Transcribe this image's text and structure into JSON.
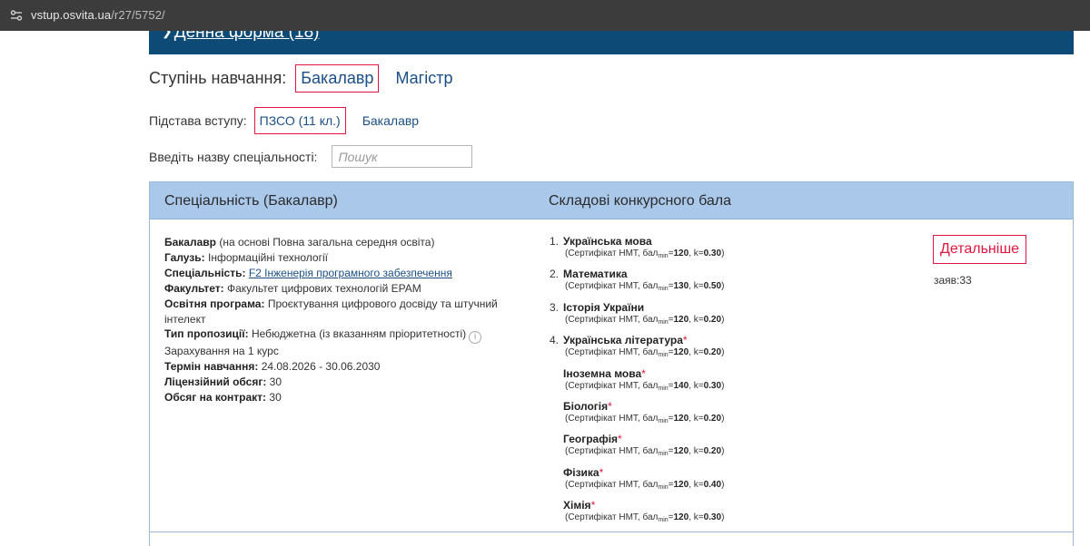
{
  "browser": {
    "url_host": "vstup.osvita.ua",
    "url_path": "/r27/5752/"
  },
  "strip": {
    "label": "Денна форма (18)"
  },
  "degree": {
    "label": "Ступінь навчання:",
    "options": [
      "Бакалавр",
      "Магістр"
    ],
    "selected": "Бакалавр"
  },
  "basis": {
    "label": "Підстава вступу:",
    "options": [
      "ПЗСО (11 кл.)",
      "Бакалавр"
    ],
    "selected": "ПЗСО (11 кл.)"
  },
  "search": {
    "label": "Введіть назву спеціальності:",
    "placeholder": "Пошук"
  },
  "table": {
    "col_spec": "Спеціальність (Бакалавр)",
    "col_score": "Складові конкурсного бала"
  },
  "offer": {
    "degree": "Бакалавр",
    "degree_note": "(на основі Повна загальна середня освіта)",
    "field_label": "Галузь:",
    "field_value": "Інформаційні технології",
    "spec_label": "Спеціальність:",
    "spec_value": "F2 Інженерія програмного забезпечення",
    "faculty_label": "Факультет:",
    "faculty_value": "Факультет цифрових технологій EPAM",
    "program_label": "Освітня програма:",
    "program_value": "Проєктування цифрового досвіду та штучний інтелект",
    "type_label": "Тип пропозиції:",
    "type_value": "Небюджетна (із вказанням пріоритетності)",
    "enroll": "Зарахування на 1 курс",
    "term_label": "Термін навчання:",
    "term_value": "24.08.2026 - 30.06.2030",
    "license_label": "Ліцензійний обсяг:",
    "license_value": "30",
    "contract_label": "Обсяг на контракт:",
    "contract_value": "30"
  },
  "subjects": [
    {
      "num": "1.",
      "name": "Українська мова",
      "required_mark": "",
      "min": "120",
      "k": "0.30"
    },
    {
      "num": "2.",
      "name": "Математика",
      "required_mark": "",
      "min": "130",
      "k": "0.50"
    },
    {
      "num": "3.",
      "name": "Історія України",
      "required_mark": "",
      "min": "120",
      "k": "0.20"
    },
    {
      "num": "4.",
      "name": "Українська література",
      "required_mark": "*",
      "min": "120",
      "k": "0.20"
    },
    {
      "num": "",
      "name": "Іноземна мова",
      "required_mark": "*",
      "min": "140",
      "k": "0.30"
    },
    {
      "num": "",
      "name": "Біологія",
      "required_mark": "*",
      "min": "120",
      "k": "0.20"
    },
    {
      "num": "",
      "name": "Географія",
      "required_mark": "*",
      "min": "120",
      "k": "0.20"
    },
    {
      "num": "",
      "name": "Фізика",
      "required_mark": "*",
      "min": "120",
      "k": "0.40"
    },
    {
      "num": "",
      "name": "Хімія",
      "required_mark": "*",
      "min": "120",
      "k": "0.30"
    }
  ],
  "cert": {
    "prefix": "(Сертифікат НМТ, бал",
    "min_sub": "min",
    "k_label": "k="
  },
  "right": {
    "details_label": "Детальніше",
    "apps": "заяв:33"
  }
}
